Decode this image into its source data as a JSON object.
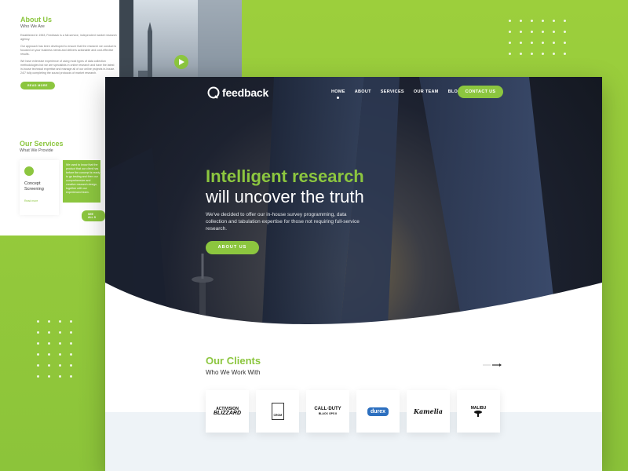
{
  "about_preview": {
    "title": "About Us",
    "subtitle": "Who We Are",
    "para1": "Established in 1963, Feedback is a full-service, independent market research agency.",
    "para2": "Our approach has been developed to ensure that the research we conduct is focused on your business needs and delivers actionable and cost-effective results.",
    "para3": "We have extensive experience of using most types of data collection methodologies but we are specialists in online research and have the latest in-house technical expertise and manage all of our online projects in-house. 24/7 fully completing the sound protocols of market research.",
    "button": "READ MORE"
  },
  "services_preview": {
    "title": "Our Services",
    "subtitle": "What We Provide",
    "service_title": "Concept Screening",
    "service_link": "Read more",
    "green_para": "We used to know that the product that our client has before the concept is ready to go testing and then our comprehensive and creative research design, together with our experienced team.",
    "see_all": "SEE ALL S"
  },
  "nav": {
    "logo": "feedback",
    "items": [
      "HOME",
      "ABOUT",
      "SERVICES",
      "OUR TEAM",
      "BLOGS"
    ],
    "active": "HOME",
    "contact": "CONTACT US"
  },
  "hero": {
    "headline_green": "Intelligent research",
    "headline_white": "will uncover the truth",
    "description": "We've decided to offer our in-house survey programming, data collection and tabulation expertise for those not requiring full-service research.",
    "button": "ABOUT US"
  },
  "clients": {
    "title": "Our Clients",
    "subtitle": "Who We Work With",
    "logos": [
      {
        "name": "activision-blizzard",
        "text1": "ACTIVISION",
        "text2": "BLIZZARD"
      },
      {
        "name": "crom",
        "text1": "CROM",
        "text2": ""
      },
      {
        "name": "call-of-duty",
        "text1": "CALL·DUTY",
        "text2": "BLACK OPS II"
      },
      {
        "name": "durex",
        "text1": "durex",
        "text2": ""
      },
      {
        "name": "kamelia",
        "text1": "Kamelia",
        "text2": ""
      },
      {
        "name": "malibu",
        "text1": "MALIBU",
        "text2": ""
      }
    ]
  },
  "colors": {
    "brand_green": "#8cc63f",
    "hero_dark": "#141821",
    "text_dark": "#333333"
  }
}
